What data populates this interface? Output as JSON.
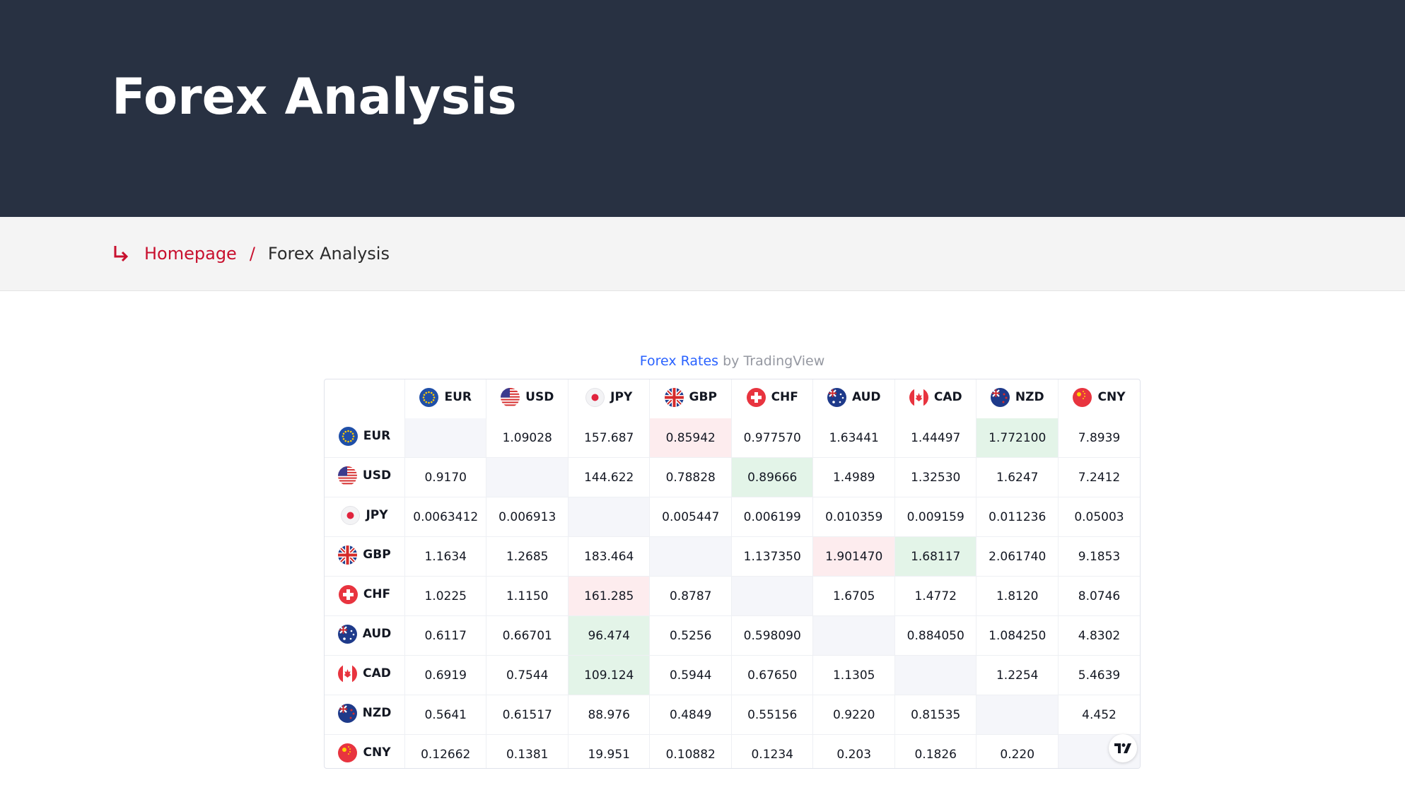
{
  "header": {
    "title": "Forex Analysis"
  },
  "breadcrumb": {
    "home": "Homepage",
    "separator": "/",
    "current": "Forex Analysis"
  },
  "widget": {
    "title_link": "Forex Rates",
    "title_by": "by",
    "title_brand": "TradingView"
  },
  "colors": {
    "header_bg": "#283142",
    "accent": "#c8102e",
    "link": "#2962ff",
    "up": "#e3f4e8",
    "down": "#fdecee"
  },
  "currencies": [
    {
      "code": "EUR",
      "flag": "eu-flag-icon"
    },
    {
      "code": "USD",
      "flag": "us-flag-icon"
    },
    {
      "code": "JPY",
      "flag": "jp-flag-icon"
    },
    {
      "code": "GBP",
      "flag": "gb-flag-icon"
    },
    {
      "code": "CHF",
      "flag": "ch-flag-icon"
    },
    {
      "code": "AUD",
      "flag": "au-flag-icon"
    },
    {
      "code": "CAD",
      "flag": "ca-flag-icon"
    },
    {
      "code": "NZD",
      "flag": "nz-flag-icon"
    },
    {
      "code": "CNY",
      "flag": "cn-flag-icon"
    }
  ],
  "rates": [
    [
      "",
      "1.09028",
      "157.687",
      "0.85942",
      "0.977570",
      "1.63441",
      "1.44497",
      "1.772100",
      "7.8939"
    ],
    [
      "0.9170",
      "",
      "144.622",
      "0.78828",
      "0.89666",
      "1.4989",
      "1.32530",
      "1.6247",
      "7.2412"
    ],
    [
      "0.0063412",
      "0.006913",
      "",
      "0.005447",
      "0.006199",
      "0.010359",
      "0.009159",
      "0.011236",
      "0.05003"
    ],
    [
      "1.1634",
      "1.2685",
      "183.464",
      "",
      "1.137350",
      "1.901470",
      "1.68117",
      "2.061740",
      "9.1853"
    ],
    [
      "1.0225",
      "1.1150",
      "161.285",
      "0.8787",
      "",
      "1.6705",
      "1.4772",
      "1.8120",
      "8.0746"
    ],
    [
      "0.6117",
      "0.66701",
      "96.474",
      "0.5256",
      "0.598090",
      "",
      "0.884050",
      "1.084250",
      "4.8302"
    ],
    [
      "0.6919",
      "0.7544",
      "109.124",
      "0.5944",
      "0.67650",
      "1.1305",
      "",
      "1.2254",
      "5.4639"
    ],
    [
      "0.5641",
      "0.61517",
      "88.976",
      "0.4849",
      "0.55156",
      "0.9220",
      "0.81535",
      "",
      "4.452"
    ],
    [
      "0.12662",
      "0.1381",
      "19.951",
      "0.10882",
      "0.1234",
      "0.203",
      "0.1826",
      "0.220",
      ""
    ]
  ],
  "highlights": [
    [
      "",
      "",
      "",
      "neg",
      "",
      "",
      "",
      "pos",
      ""
    ],
    [
      "",
      "",
      "",
      "",
      "pos",
      "",
      "",
      "",
      ""
    ],
    [
      "",
      "",
      "",
      "",
      "",
      "",
      "",
      "",
      ""
    ],
    [
      "",
      "",
      "",
      "",
      "",
      "neg",
      "pos",
      "",
      ""
    ],
    [
      "",
      "",
      "neg",
      "",
      "",
      "",
      "",
      "",
      ""
    ],
    [
      "",
      "",
      "pos",
      "",
      "",
      "",
      "",
      "",
      ""
    ],
    [
      "",
      "",
      "pos",
      "",
      "",
      "",
      "",
      "",
      ""
    ],
    [
      "",
      "",
      "",
      "",
      "",
      "",
      "",
      "",
      ""
    ],
    [
      "",
      "",
      "",
      "",
      "",
      "",
      "",
      "",
      ""
    ]
  ],
  "badge": {
    "icon": "tradingview-logo-icon"
  }
}
